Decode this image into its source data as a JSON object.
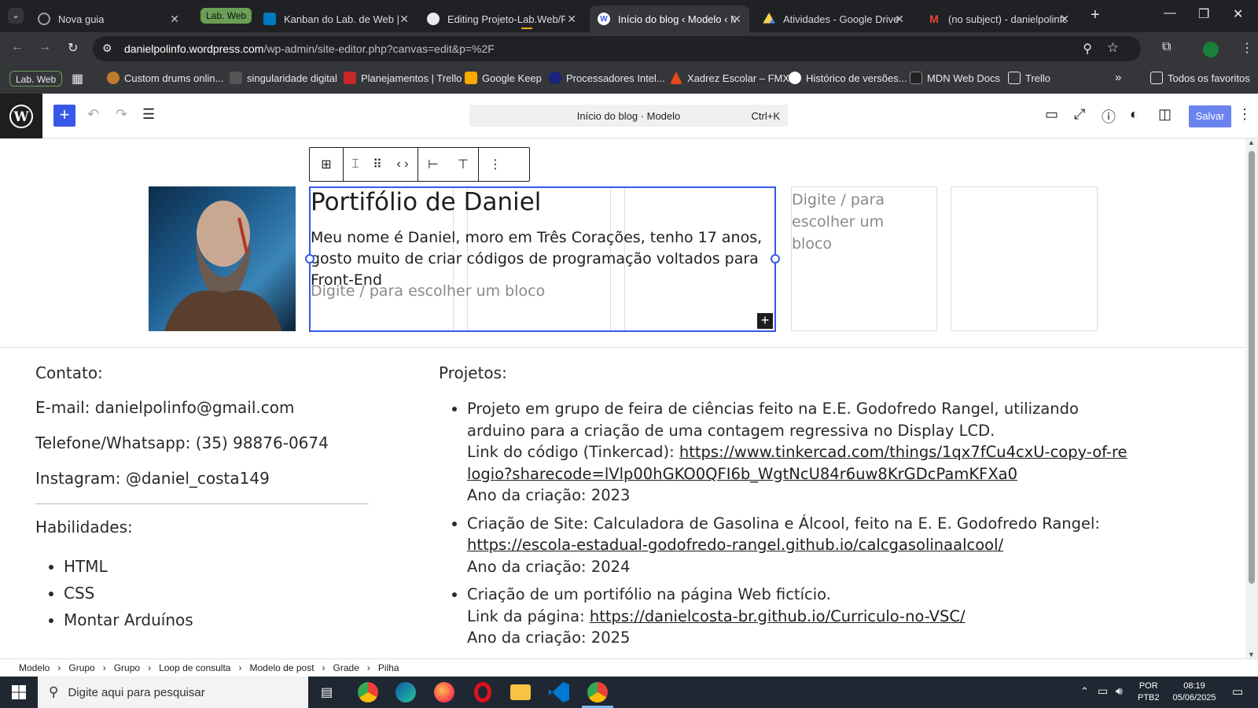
{
  "browser": {
    "tabs": [
      {
        "title": "Nova guia",
        "icon": "chrome-icon"
      },
      {
        "title": "Kanban do Lab. de Web | T",
        "icon": "trello-icon"
      },
      {
        "title": "Editing Projeto-Lab.Web/R",
        "icon": "github-icon"
      },
      {
        "title": "Início do blog ‹ Modelo ‹ M",
        "icon": "wordpress-icon"
      },
      {
        "title": "Atividades - Google Drive",
        "icon": "drive-icon"
      },
      {
        "title": "(no subject) - danielpolinfo",
        "icon": "gmail-icon"
      }
    ],
    "group_chip": "Lab. Web",
    "url_host": "danielpolinfo.wordpress.com",
    "url_path": "/wp-admin/site-editor.php?canvas=edit&p=%2F",
    "bookmarks": [
      {
        "label": "Custom drums onlin...",
        "color": "#c07b2c"
      },
      {
        "label": "singularidade digital",
        "color": "#555555"
      },
      {
        "label": "Planejamentos | Trello",
        "color": "#c62828"
      },
      {
        "label": "Google Keep",
        "color": "#f9ab00"
      },
      {
        "label": "Processadores Intel...",
        "color": "#1a237e"
      },
      {
        "label": "Xadrez Escolar – FMX",
        "color": "#e64a19"
      },
      {
        "label": "Histórico de versões...",
        "color": "#ffffff"
      },
      {
        "label": "MDN Web Docs",
        "color": "#222222"
      },
      {
        "label": "Trello",
        "color": "#35363a"
      }
    ],
    "all_bookmarks": "Todos os favoritos"
  },
  "editor": {
    "command_title": "Início do blog · Modelo",
    "shortcut": "Ctrl+K",
    "save_label": "Salvar"
  },
  "hero": {
    "title": "Portifólio de Daniel",
    "bio": "Meu nome é Daniel, moro em Três Corações, tenho 17 anos, gosto muito de criar códigos de programação voltados para Front-End",
    "placeholder": "Digite / para escolher um bloco",
    "side_placeholder": "Digite / para escolher um bloco"
  },
  "contact": {
    "heading": "Contato:",
    "email": "E-mail: danielpolinfo@gmail.com",
    "phone": "Telefone/Whatsapp: (35) 98876-0674",
    "instagram": "Instagram: @daniel_costa149"
  },
  "skills": {
    "heading": "Habilidades:",
    "items": [
      "HTML",
      "CSS",
      "Montar Arduínos"
    ]
  },
  "projects": {
    "heading": "Projetos:",
    "items": [
      {
        "desc": "Projeto em grupo de feira de ciências feito na E.E. Godofredo Rangel, utilizando arduino para a criação de uma contagem regressiva no Display LCD.",
        "link_label": "Link do código (Tinkercad): ",
        "link": "https://www.tinkercad.com/things/1qx7fCu4cxU-copy-of-relogio?sharecode=lVlp00hGKO0QFI6b_WgtNcU84r6uw8KrGDcPamKFXa0",
        "year": "Ano da criação: 2023"
      },
      {
        "desc": "Criação de Site: Calculadora de Gasolina e Álcool, feito na E. E. Godofredo Rangel: ",
        "link_label": "",
        "link": "https://escola-estadual-godofredo-rangel.github.io/calcgasolinaalcool/",
        "year": "Ano da criação: 2024"
      },
      {
        "desc": "Criação de um portifólio na página Web fictício.",
        "link_label": "Link da página: ",
        "link": "https://danielcosta-br.github.io/Curriculo-no-VSC/",
        "year": "Ano da criação: 2025"
      }
    ]
  },
  "breadcrumbs": [
    "Modelo",
    "Grupo",
    "Grupo",
    "Loop de consulta",
    "Modelo de post",
    "Grade",
    "Pilha"
  ],
  "taskbar": {
    "search_placeholder": "Digite aqui para pesquisar",
    "lang": "POR",
    "layout": "PTB2",
    "time": "08:19",
    "date": "05/06/2025"
  }
}
